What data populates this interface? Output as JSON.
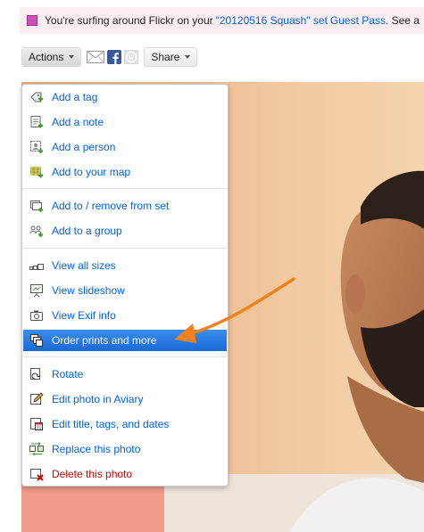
{
  "banner": {
    "prefix": "You're surfing around Flickr on your",
    "set_link": "\"20120516 Squash\" set",
    "guest_pass_link": "Guest Pass",
    "suffix": ". See a",
    "icon": "pink-square-icon"
  },
  "toolbar": {
    "actions_label": "Actions",
    "share_label": "Share",
    "icons": [
      "mail-icon",
      "facebook-icon",
      "wordpress-icon"
    ]
  },
  "menu": {
    "groups": [
      [
        {
          "label": "Add a tag",
          "icon": "tag-add-icon"
        },
        {
          "label": "Add a note",
          "icon": "note-add-icon"
        },
        {
          "label": "Add a person",
          "icon": "person-add-icon"
        },
        {
          "label": "Add to your map",
          "icon": "map-add-icon"
        }
      ],
      [
        {
          "label": "Add to / remove from set",
          "icon": "set-icon"
        },
        {
          "label": "Add to a group",
          "icon": "group-icon"
        }
      ],
      [
        {
          "label": "View all sizes",
          "icon": "sizes-icon"
        },
        {
          "label": "View slideshow",
          "icon": "slideshow-icon"
        },
        {
          "label": "View Exif info",
          "icon": "camera-icon"
        },
        {
          "label": "Order prints and more",
          "icon": "prints-icon",
          "active": true
        }
      ],
      [
        {
          "label": "Rotate",
          "icon": "rotate-icon"
        },
        {
          "label": "Edit photo in Aviary",
          "icon": "edit-icon"
        },
        {
          "label": "Edit title, tags, and dates",
          "icon": "calendar-icon"
        },
        {
          "label": "Replace this photo",
          "icon": "replace-icon"
        },
        {
          "label": "Delete this photo",
          "icon": "delete-icon",
          "danger": true
        }
      ]
    ]
  },
  "colors": {
    "link": "#0063dc",
    "highlight": "#1d6fdc",
    "danger": "#cc0000",
    "arrow": "#f0821e",
    "banner_bg": "#fdeef3"
  }
}
